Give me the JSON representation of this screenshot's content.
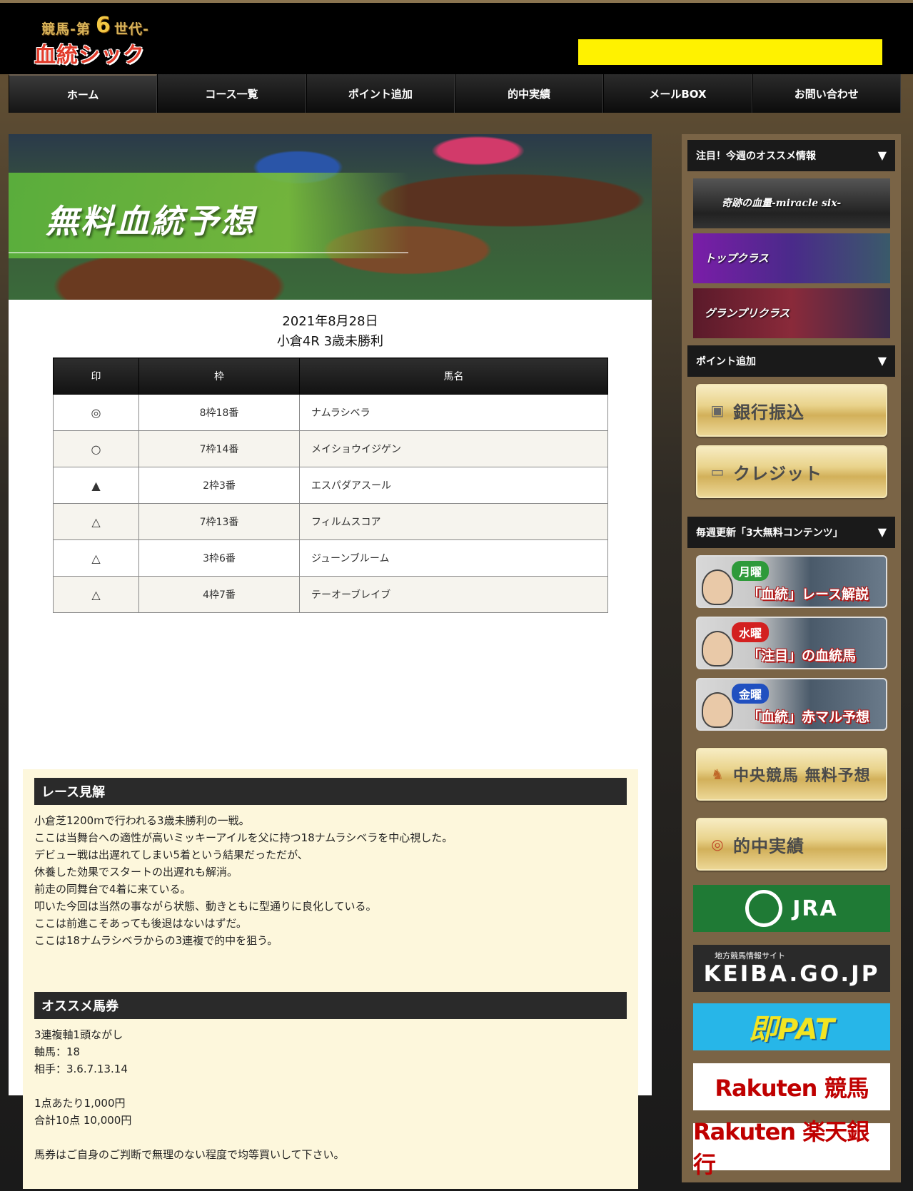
{
  "header": {
    "logo_top": "競馬-第",
    "logo_six": "6",
    "logo_sub": "世代-",
    "logo_main": "血統シックス"
  },
  "nav": {
    "items": [
      "ホーム",
      "コース一覧",
      "ポイント追加",
      "的中実績",
      "メールBOX",
      "お問い合わせ"
    ]
  },
  "hero": {
    "title": "無料血統予想"
  },
  "race": {
    "date": "2021年8月28日",
    "name": "小倉4R 3歳未勝利"
  },
  "table": {
    "headers": [
      "印",
      "枠",
      "馬名"
    ],
    "rows": [
      {
        "mark": "◎",
        "waku": "8枠18番",
        "name": "ナムラシベラ"
      },
      {
        "mark": "○",
        "waku": "7枠14番",
        "name": "メイショウイジゲン"
      },
      {
        "mark": "▲",
        "waku": "2枠3番",
        "name": "エスパダアスール"
      },
      {
        "mark": "△",
        "waku": "7枠13番",
        "name": "フィルムスコア"
      },
      {
        "mark": "△",
        "waku": "3枠6番",
        "name": "ジューンブルーム"
      },
      {
        "mark": "△",
        "waku": "4枠7番",
        "name": "テーオーブレイブ"
      }
    ]
  },
  "analysis": {
    "heading": "レース見解",
    "lines": [
      "小倉芝1200mで行われる3歳未勝利の一戦。",
      "ここは当舞台への適性が高いミッキーアイルを父に持つ18ナムラシベラを中心視した。",
      "デビュー戦は出遅れてしまい5着という結果だっただが、",
      "休養した効果でスタートの出遅れも解消。",
      "前走の同舞台で4着に来ている。",
      "叩いた今回は当然の事ながら状態、動きともに型通りに良化している。",
      "ここは前進こそあっても後退はないはずだ。",
      "ここは18ナムラシベラからの3連複で的中を狙う。"
    ]
  },
  "recommend": {
    "heading": "オススメ馬券",
    "lines": [
      "3連複軸1頭ながし",
      "軸馬：18",
      "相手：3.6.7.13.14",
      "",
      "1点あたり1,000円",
      "合計10点 10,000円",
      "",
      "馬券はご自身のご判断で無理のない程度で均等買いして下さい。"
    ]
  },
  "sidebar": {
    "section1": "注目！今週のオススメ情報",
    "banners": [
      "奇跡の血量-miracle six-",
      "トップクラス",
      "グランプリクラス"
    ],
    "section2": "ポイント追加",
    "pay_bank": "銀行振込",
    "pay_credit": "クレジット",
    "section3": "毎週更新「3大無料コンテンツ」",
    "weekly": [
      {
        "day": "月曜",
        "title": "「血統」レース解説",
        "color": "#2e9a3a"
      },
      {
        "day": "水曜",
        "title": "「注目」の血統馬",
        "color": "#d32020"
      },
      {
        "day": "金曜",
        "title": "「血統」赤マル予想",
        "color": "#2050c0"
      }
    ],
    "free_pred": "中央競馬 無料予想",
    "results": "的中実績",
    "jra": "JRA",
    "keiba_small": "地方競馬情報サイト",
    "keiba": "KEIBA.GO.JP",
    "pat": "即PAT",
    "rakuten_keiba": "Rakuten 競馬",
    "rakuten_bank": "Rakuten 楽天銀行"
  }
}
